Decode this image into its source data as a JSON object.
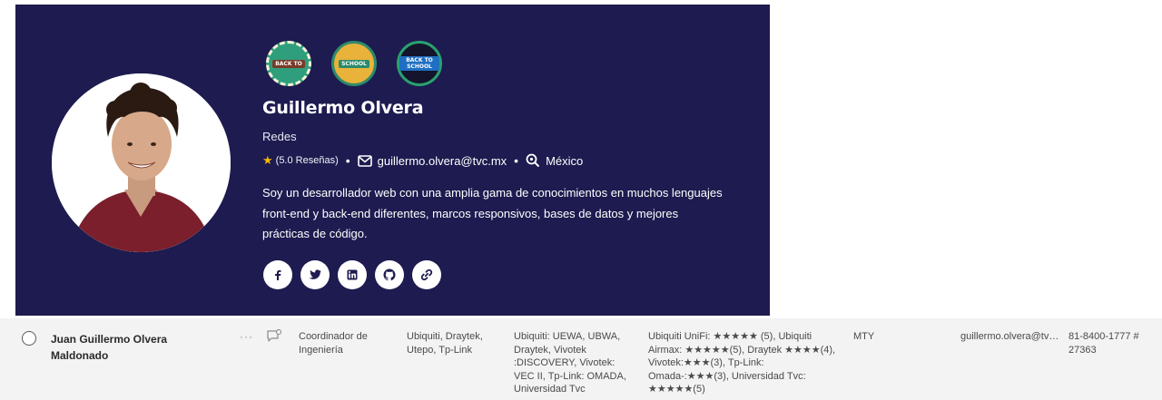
{
  "profile": {
    "name": "Guillermo Olvera",
    "role": "Redes",
    "rating": "(5.0 Reseñas)",
    "email": "guillermo.olvera@tvc.mx",
    "location": "México",
    "bio": "Soy un desarrollador web con una amplia gama de conocimientos en muchos lenguajes front-end y back-end diferentes, marcos responsivos, bases de datos y mejores prácticas de código.",
    "badges": [
      {
        "label": "BACK TO"
      },
      {
        "label": "SCHOOL"
      },
      {
        "label": "BACK TO SCHOOL"
      }
    ],
    "socials": [
      "facebook-icon",
      "twitter-icon",
      "linkedin-icon",
      "github-icon",
      "link-icon"
    ],
    "colors": {
      "card_bg": "#1d1b4f",
      "star": "#f5b800"
    }
  },
  "row": {
    "name": "Juan Guillermo Olvera Maldonado",
    "more": "···",
    "title": "Coordinador de Ingeniería",
    "brands": "Ubiquiti, Draytek, Utepo, Tp-Link",
    "certifications": "Ubiquiti: UEWA, UBWA, Draytek, Vivotek :DISCOVERY, Vivotek: VEC II, Tp-Link: OMADA, Universidad Tvc",
    "skills": "Ubiquiti UniFi: ★★★★★ (5), Ubiquiti Airmax: ★★★★★(5), Draytek ★★★★(4), Vivotek:★★★(3), Tp-Link: Omada-:★★★(3), Universidad Tvc: ★★★★★(5)",
    "location": "MTY",
    "email": "guillermo.olvera@tvc.mx",
    "phone": "81-8400-1777 # 27363"
  }
}
